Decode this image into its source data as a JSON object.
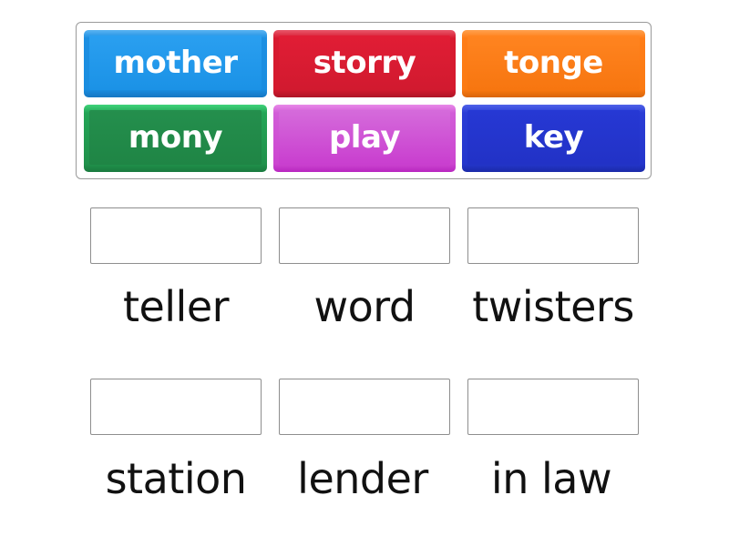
{
  "tiles": [
    {
      "label": "mother",
      "color": "#1b92e6"
    },
    {
      "label": "storry",
      "color": "#d81a30"
    },
    {
      "label": "tonge",
      "color": "#ff7d17"
    },
    {
      "label": "mony",
      "color": "#21904b"
    },
    {
      "label": "play",
      "color": "#cc45d0"
    },
    {
      "label": "key",
      "color": "#2436cc"
    }
  ],
  "targets": [
    {
      "word": "teller",
      "placed": ""
    },
    {
      "word": "word",
      "placed": ""
    },
    {
      "word": "twisters",
      "placed": ""
    },
    {
      "word": "station",
      "placed": ""
    },
    {
      "word": "lender",
      "placed": ""
    },
    {
      "word": "in law",
      "placed": ""
    }
  ]
}
